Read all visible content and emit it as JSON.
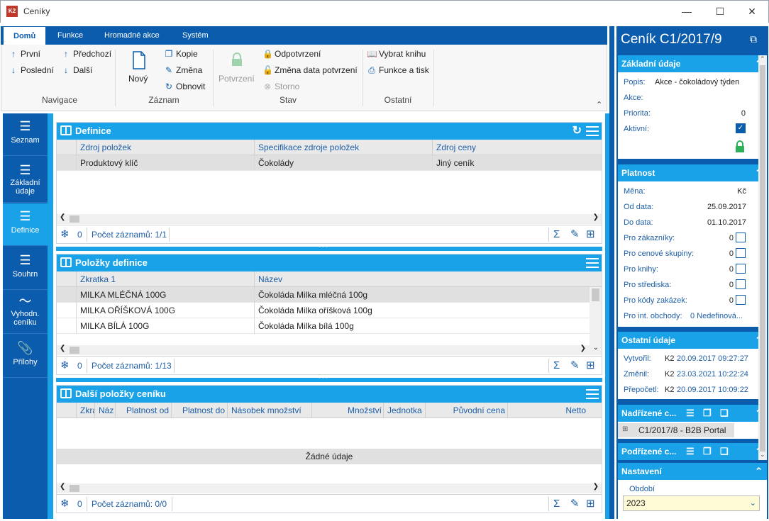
{
  "window": {
    "title": "Ceníky",
    "icon_text": "K2"
  },
  "ribbon": {
    "tabs": [
      "Domů",
      "Funkce",
      "Hromadné akce",
      "Systém"
    ],
    "nav": {
      "first": "První",
      "last": "Poslední",
      "prev": "Předchozí",
      "next": "Další",
      "group": "Navigace"
    },
    "record": {
      "new": "Nový",
      "copy": "Kopie",
      "change": "Změna",
      "refresh": "Obnovit",
      "group": "Záznam"
    },
    "state": {
      "confirm": "Potvrzení",
      "unconfirm": "Odpotvrzení",
      "change_date": "Změna data potvrzení",
      "cancel": "Storno",
      "group": "Stav"
    },
    "other": {
      "choose_book": "Vybrat knihu",
      "functions_print": "Funkce a tisk",
      "group": "Ostatní"
    }
  },
  "leftnav": [
    {
      "label": "Seznam"
    },
    {
      "label": "Základní údaje"
    },
    {
      "label": "Definice"
    },
    {
      "label": "Souhrn"
    },
    {
      "label": "Vyhodn. ceníku"
    },
    {
      "label": "Přílohy"
    }
  ],
  "definice": {
    "title": "Definice",
    "columns": [
      "Zdroj položek",
      "Specifikace zdroje položek",
      "Zdroj ceny"
    ],
    "rows": [
      [
        "Produktový klíč",
        "Čokolády",
        "Jiný ceník"
      ]
    ],
    "footer": {
      "count": "0",
      "records": "Počet záznamů: 1/1"
    }
  },
  "polozky": {
    "title": "Položky definice",
    "columns": [
      "Zkratka 1",
      "Název"
    ],
    "rows": [
      [
        "MILKA MLÉČNÁ 100G",
        "Čokoláda Milka mléčná 100g"
      ],
      [
        "MILKA OŘÍŠKOVÁ 100G",
        "Čokoláda Milka oříšková 100g"
      ],
      [
        "MILKA BÍLÁ 100G",
        "Čokoláda Milka bílá 100g"
      ]
    ],
    "footer": {
      "count": "0",
      "records": "Počet záznamů: 1/13"
    }
  },
  "dalsi": {
    "title": "Další položky ceníku",
    "columns": [
      "Zkra",
      "Náz",
      "Platnost od",
      "Platnost do",
      "Násobek množství",
      "Množství",
      "Jednotka",
      "Původní cena",
      "Netto"
    ],
    "empty": "Žádné údaje",
    "footer": {
      "count": "0",
      "records": "Počet záznamů: 0/0"
    }
  },
  "right": {
    "title": "Ceník C1/2017/9",
    "zakladni": {
      "header": "Základní údaje",
      "popis_label": "Popis:",
      "popis": "Akce - čokoládový týden",
      "akce_label": "Akce:",
      "priorita_label": "Priorita:",
      "priorita": "0",
      "aktivni_label": "Aktivní:"
    },
    "platnost": {
      "header": "Platnost",
      "mena_label": "Měna:",
      "mena": "Kč",
      "od_label": "Od data:",
      "od": "25.09.2017",
      "do_label": "Do data:",
      "do": "01.10.2017",
      "rows": [
        {
          "label": "Pro zákazníky:",
          "value": "0"
        },
        {
          "label": "Pro cenové skupiny:",
          "value": "0"
        },
        {
          "label": "Pro knihy:",
          "value": "0"
        },
        {
          "label": "Pro střediska:",
          "value": "0"
        },
        {
          "label": "Pro kódy zakázek:",
          "value": "0"
        }
      ],
      "int_label": "Pro int. obchody:",
      "int_value": "0 Nedefinová..."
    },
    "ostatni": {
      "header": "Ostatní údaje",
      "vytvoril_label": "Vytvořil:",
      "vytvoril_user": "K2",
      "vytvoril_date": "20.09.2017 09:27:27",
      "zmenil_label": "Změnil:",
      "zmenil_user": "K2",
      "zmenil_date": "23.03.2021 10:22:24",
      "prepocetl_label": "Přepočetl:",
      "prepocetl_user": "K2",
      "prepocetl_date": "20.09.2017 10:09:22"
    },
    "nadrizene": {
      "header": "Nadřízené c...",
      "item": "C1/2017/8 - B2B Portal"
    },
    "podrizene": {
      "header": "Podřízené c..."
    },
    "nastaveni": {
      "header": "Nastavení",
      "obdobi_label": "Období",
      "obdobi": "2023"
    }
  }
}
